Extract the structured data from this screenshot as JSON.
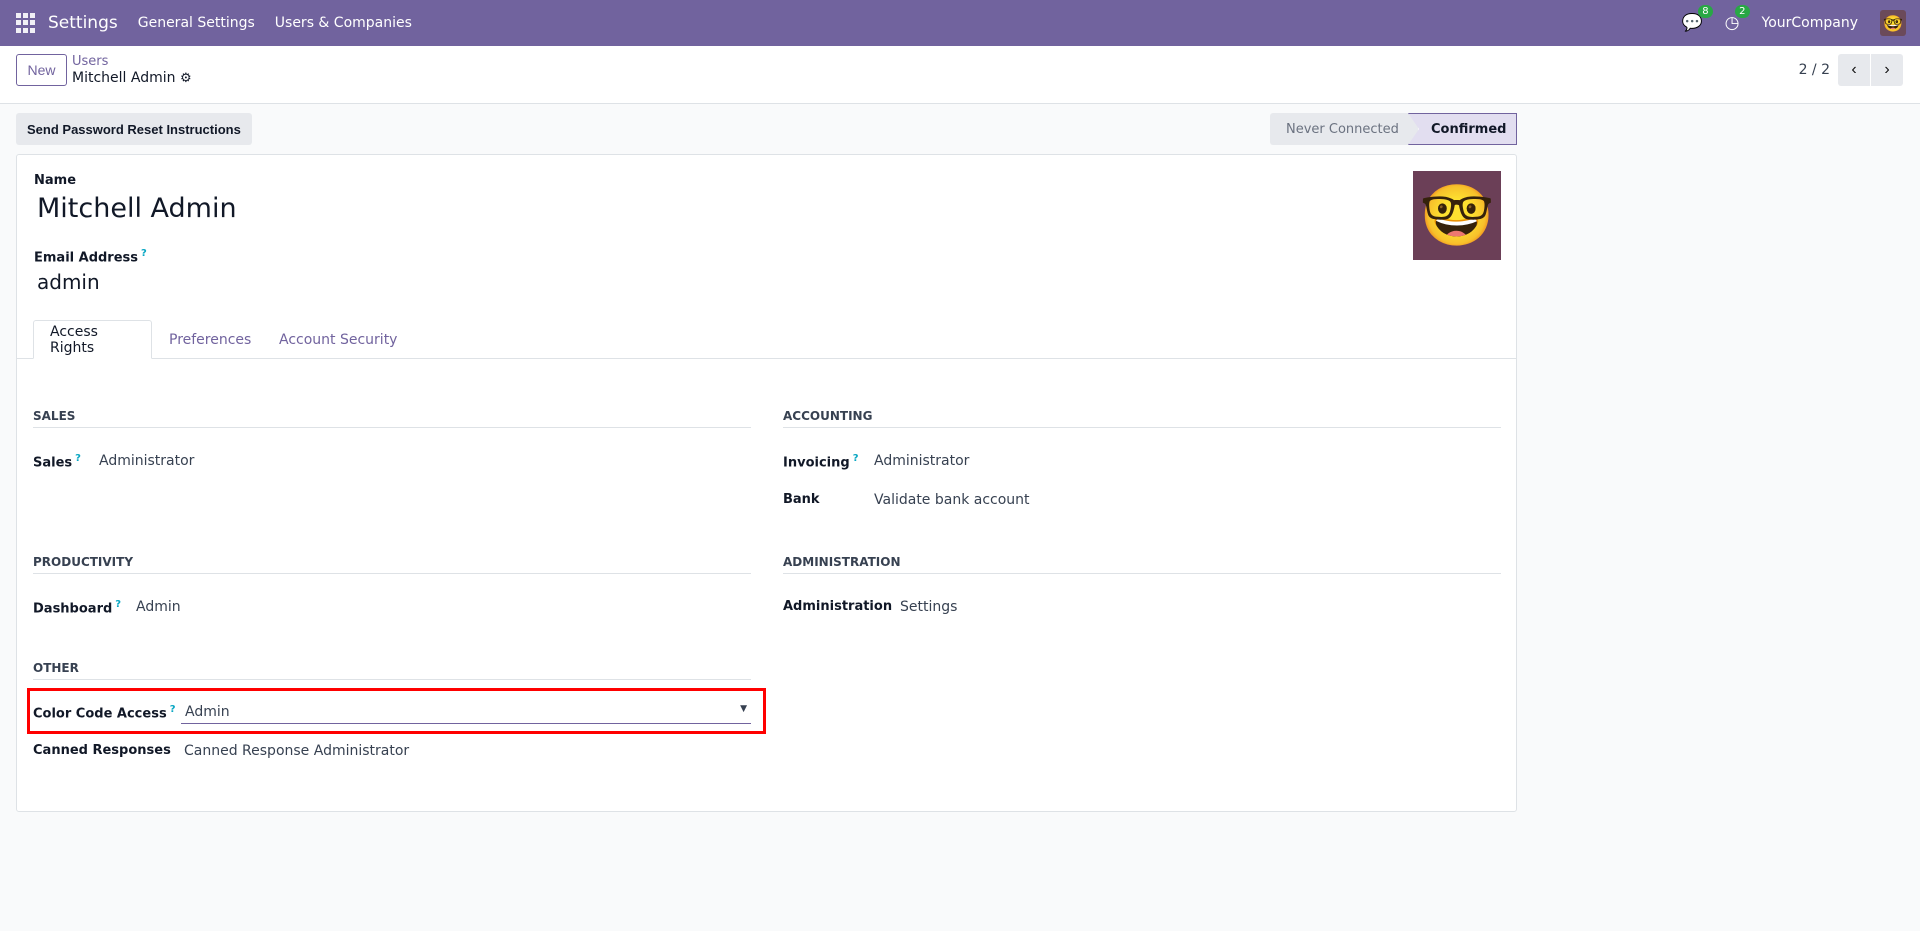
{
  "topbar": {
    "app": "Settings",
    "menus": [
      "General Settings",
      "Users & Companies"
    ],
    "messages_count": "8",
    "activities_count": "2",
    "company": "YourCompany"
  },
  "control": {
    "new_label": "New",
    "breadcrumb_parent": "Users",
    "breadcrumb_current": "Mitchell Admin",
    "pager": "2 / 2"
  },
  "statusbar": {
    "reset_label": "Send Password Reset Instructions",
    "states": [
      "Never Connected",
      "Confirmed"
    ],
    "active_state": "Confirmed"
  },
  "form": {
    "name_label": "Name",
    "name": "Mitchell Admin",
    "email_label": "Email Address",
    "email": "admin",
    "tabs": [
      "Access Rights",
      "Preferences",
      "Account Security"
    ],
    "sections": {
      "sales": {
        "title": "SALES",
        "fields": [
          {
            "label": "Sales",
            "value": "Administrator"
          }
        ]
      },
      "accounting": {
        "title": "ACCOUNTING",
        "fields": [
          {
            "label": "Invoicing",
            "value": "Administrator"
          },
          {
            "label": "Bank",
            "value": "Validate bank account"
          }
        ]
      },
      "productivity": {
        "title": "PRODUCTIVITY",
        "fields": [
          {
            "label": "Dashboard",
            "value": "Admin"
          }
        ]
      },
      "administration": {
        "title": "ADMINISTRATION",
        "fields": [
          {
            "label": "Administration",
            "value": "Settings"
          }
        ]
      },
      "other": {
        "title": "OTHER",
        "fields": [
          {
            "label": "Color Code Access",
            "value": "Admin"
          },
          {
            "label": "Canned Responses",
            "value": "Canned Response Administrator"
          }
        ]
      }
    }
  },
  "colors": {
    "brand": "#71639e",
    "highlight": "#ff0000"
  }
}
